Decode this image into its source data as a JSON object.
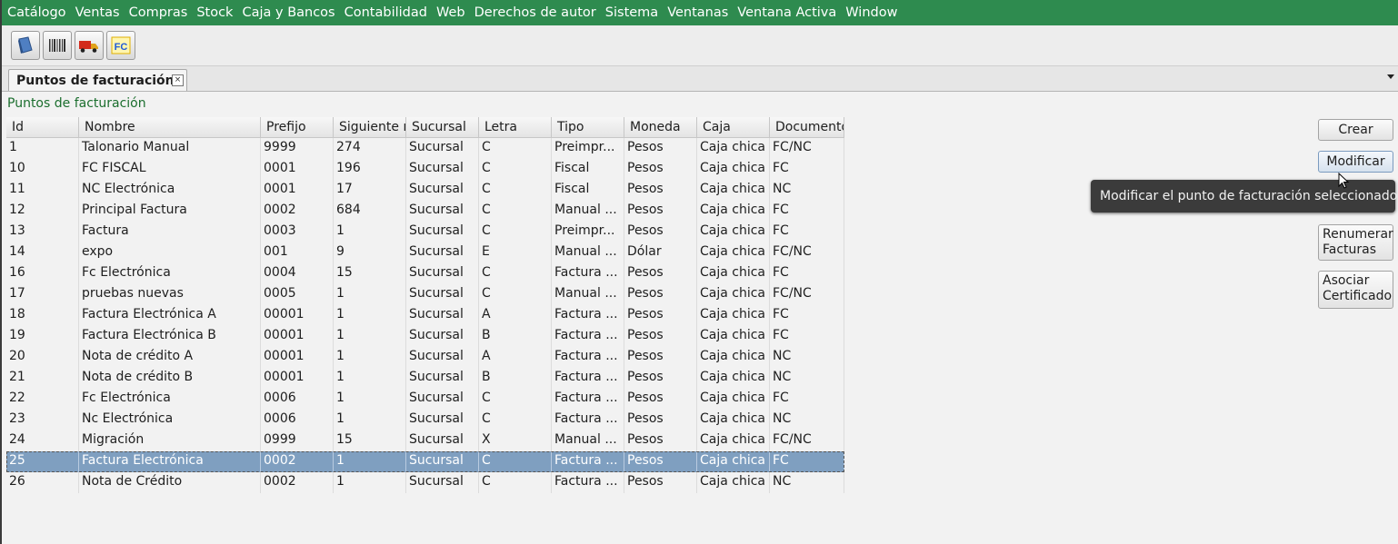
{
  "menu": [
    "Catálogo",
    "Ventas",
    "Compras",
    "Stock",
    "Caja y Bancos",
    "Contabilidad",
    "Web",
    "Derechos de autor",
    "Sistema",
    "Ventanas",
    "Ventana Activa",
    "Window"
  ],
  "toolbar": {
    "icons": [
      "book-icon",
      "barcode-icon",
      "delivery-truck-icon",
      "fc-invoice-icon"
    ],
    "fc_label": "FC"
  },
  "tab": {
    "title": "Puntos de facturación"
  },
  "page_heading": "Puntos de facturación",
  "table": {
    "columns": [
      "Id",
      "Nombre",
      "Prefijo",
      "Siguiente n",
      "Sucursal",
      "Letra",
      "Tipo",
      "Moneda",
      "Caja",
      "Documento"
    ],
    "rows": [
      [
        "1",
        "Talonario Manual",
        "9999",
        "274",
        "Sucursal",
        "C",
        "Preimpr...",
        "Pesos",
        "Caja chica",
        "FC/NC"
      ],
      [
        "10",
        "FC FISCAL",
        "0001",
        "196",
        "Sucursal",
        "C",
        "Fiscal",
        "Pesos",
        "Caja chica",
        "FC"
      ],
      [
        "11",
        "NC Electrónica",
        "0001",
        "17",
        "Sucursal",
        "C",
        "Fiscal",
        "Pesos",
        "Caja chica",
        "NC"
      ],
      [
        "12",
        "Principal Factura",
        "0002",
        "684",
        "Sucursal",
        "C",
        "Manual ...",
        "Pesos",
        "Caja chica",
        "FC"
      ],
      [
        "13",
        "Factura",
        "0003",
        "1",
        "Sucursal",
        "C",
        "Preimpr...",
        "Pesos",
        "Caja chica",
        "FC"
      ],
      [
        "14",
        "expo",
        "001",
        "9",
        "Sucursal",
        "E",
        "Manual ...",
        "Dólar",
        "Caja chica",
        "FC/NC"
      ],
      [
        "16",
        "Fc Electrónica",
        "0004",
        "15",
        "Sucursal",
        "C",
        "Factura ...",
        "Pesos",
        "Caja chica",
        "FC"
      ],
      [
        "17",
        "pruebas nuevas",
        "0005",
        "1",
        "Sucursal",
        "C",
        "Manual ...",
        "Pesos",
        "Caja chica",
        "FC/NC"
      ],
      [
        "18",
        "Factura Electrónica A",
        "00001",
        "1",
        "Sucursal",
        "A",
        "Factura ...",
        "Pesos",
        "Caja chica",
        "FC"
      ],
      [
        "19",
        "Factura Electrónica B",
        "00001",
        "1",
        "Sucursal",
        "B",
        "Factura ...",
        "Pesos",
        "Caja chica",
        "FC"
      ],
      [
        "20",
        "Nota de crédito A",
        "00001",
        "1",
        "Sucursal",
        "A",
        "Factura ...",
        "Pesos",
        "Caja chica",
        "NC"
      ],
      [
        "21",
        "Nota de crédito B",
        "00001",
        "1",
        "Sucursal",
        "B",
        "Factura ...",
        "Pesos",
        "Caja chica",
        "NC"
      ],
      [
        "22",
        "Fc Electrónica",
        "0006",
        "1",
        "Sucursal",
        "C",
        "Factura ...",
        "Pesos",
        "Caja chica",
        "FC"
      ],
      [
        "23",
        "Nc Electrónica",
        "0006",
        "1",
        "Sucursal",
        "C",
        "Factura ...",
        "Pesos",
        "Caja chica",
        "NC"
      ],
      [
        "24",
        "Migración",
        "0999",
        "15",
        "Sucursal",
        "X",
        "Manual ...",
        "Pesos",
        "Caja chica",
        "FC/NC"
      ],
      [
        "25",
        "Factura Electrónica",
        "0002",
        "1",
        "Sucursal",
        "C",
        "Factura ...",
        "Pesos",
        "Caja chica",
        "FC"
      ],
      [
        "26",
        "Nota de Crédito",
        "0002",
        "1",
        "Sucursal",
        "C",
        "Factura ...",
        "Pesos",
        "Caja chica",
        "NC"
      ]
    ],
    "selected_row_index": 15
  },
  "buttons": {
    "crear": "Crear",
    "modificar": "Modificar",
    "renumerar_line1": "Renumerar",
    "renumerar_line2": "Facturas",
    "asociar_line1": "Asociar",
    "asociar_line2": "Certificado"
  },
  "tooltip": "Modificar el punto de facturación seleccionado",
  "colors": {
    "menubar": "#2e8b4f",
    "heading": "#1b6e2e",
    "selection": "#7f9fc0",
    "tooltip_bg": "#3b3b3b"
  }
}
